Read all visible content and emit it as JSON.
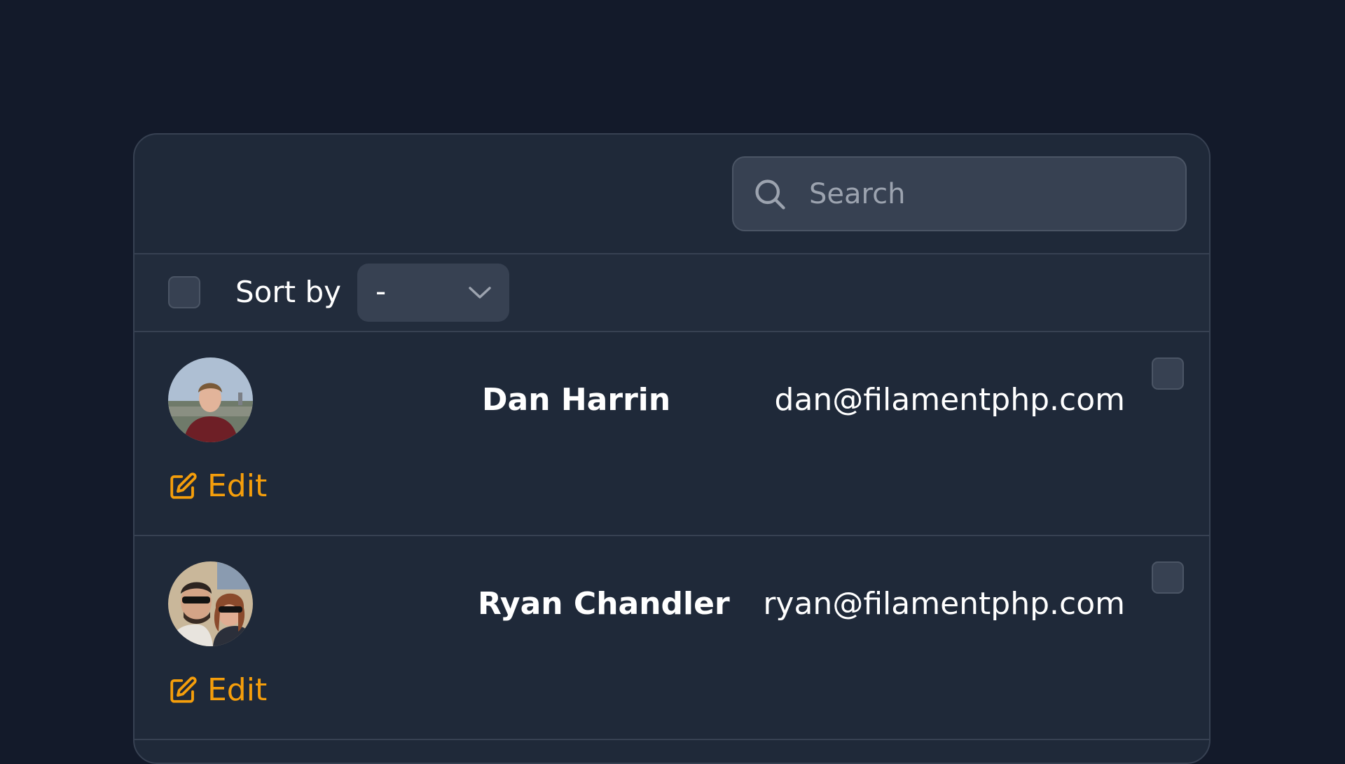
{
  "search": {
    "placeholder": "Search"
  },
  "sort": {
    "label": "Sort by",
    "selected": "-"
  },
  "records": [
    {
      "name": "Dan Harrin",
      "email": "dan@filamentphp.com",
      "edit_label": "Edit"
    },
    {
      "name": "Ryan Chandler",
      "email": "ryan@filamentphp.com",
      "edit_label": "Edit"
    }
  ],
  "colors": {
    "background": "#131a2a",
    "card": "#1f2939",
    "accent": "#f59e0b"
  }
}
